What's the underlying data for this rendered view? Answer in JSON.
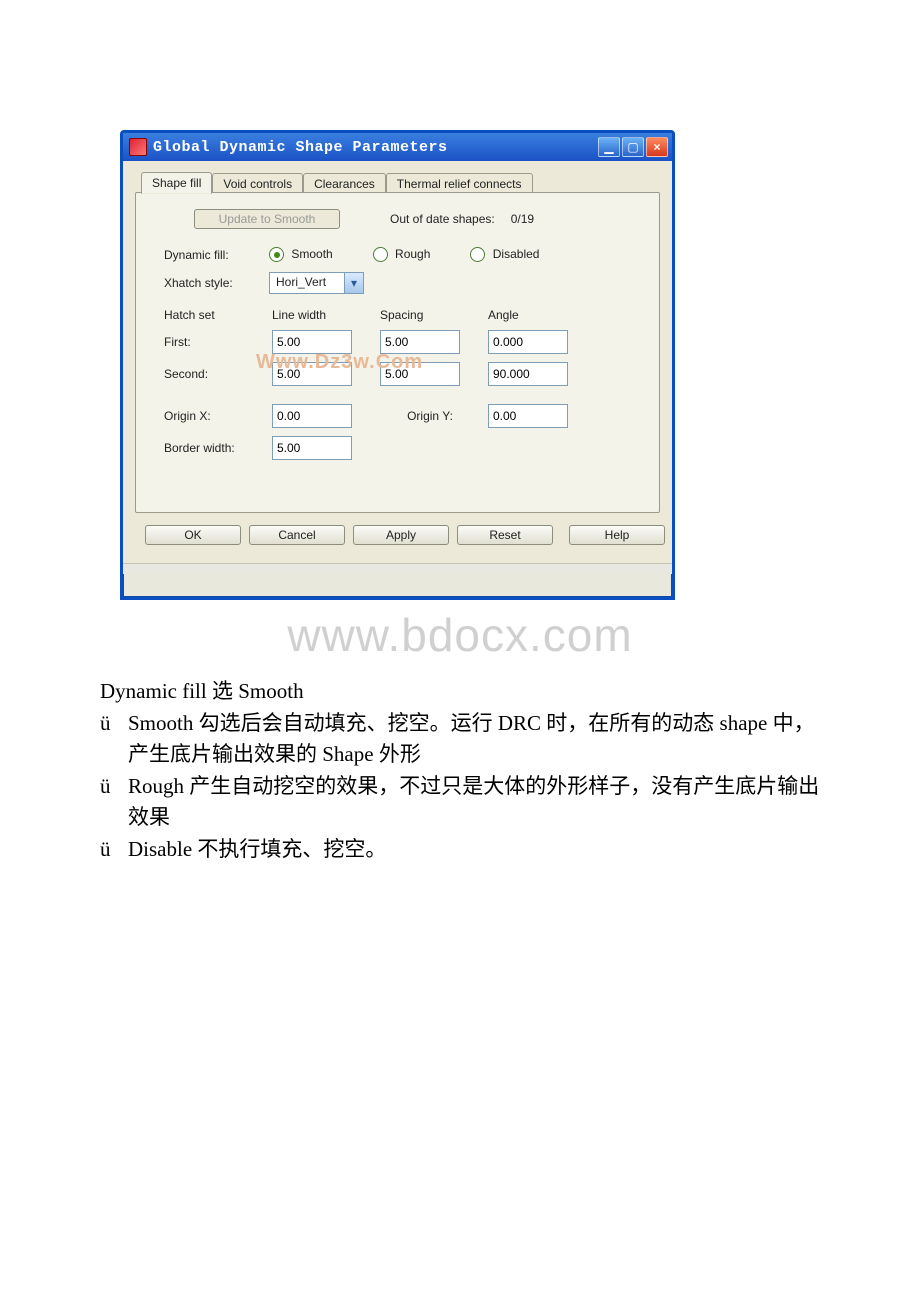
{
  "window": {
    "title": "Global Dynamic Shape Parameters",
    "min_symbol": "▁",
    "max_symbol": "▢",
    "close_symbol": "×"
  },
  "tabs": {
    "shape_fill": "Shape fill",
    "void_controls": "Void controls",
    "clearances": "Clearances",
    "thermal_relief": "Thermal relief connects"
  },
  "shapefill": {
    "update_btn": "Update to Smooth",
    "out_of_date_label": "Out of date shapes:",
    "out_of_date_value": "0/19",
    "dynamic_fill_label": "Dynamic fill:",
    "radio_smooth": "Smooth",
    "radio_rough": "Rough",
    "radio_disabled": "Disabled",
    "xhatch_style_label": "Xhatch style:",
    "xhatch_value": "Hori_Vert",
    "combo_arrow": "▾",
    "hatchset_label": "Hatch set",
    "linewidth_label": "Line width",
    "spacing_label": "Spacing",
    "angle_label": "Angle",
    "first_label": "First:",
    "second_label": "Second:",
    "first_linewidth": "5.00",
    "first_spacing": "5.00",
    "first_angle": "0.000",
    "second_linewidth": "5.00",
    "second_spacing": "5.00",
    "second_angle": "90.000",
    "originx_label": "Origin X:",
    "originx_value": "0.00",
    "originy_label": "Origin Y:",
    "originy_value": "0.00",
    "borderwidth_label": "Border width:",
    "borderwidth_value": "5.00"
  },
  "buttons": {
    "ok": "OK",
    "cancel": "Cancel",
    "apply": "Apply",
    "reset": "Reset",
    "help": "Help"
  },
  "watermarks": {
    "wm1": "Www.Dz3w.Com",
    "wm2": "www.bdocx.com"
  },
  "doc": {
    "line1": "Dynamic fill 选 Smooth",
    "bullet": "ü",
    "item1_lead": "Smooth",
    "item1_rest": " 勾选后会自动填充、挖空。运行 DRC 时，在所有的动态 shape 中，产生底片输出效果的 Shape 外形",
    "item2_lead": "Rough",
    "item2_rest": "  产生自动挖空的效果，不过只是大体的外形样子，没有产生底片输出效果",
    "item3_lead": "Disable",
    "item3_rest": " 不执行填充、挖空。"
  }
}
